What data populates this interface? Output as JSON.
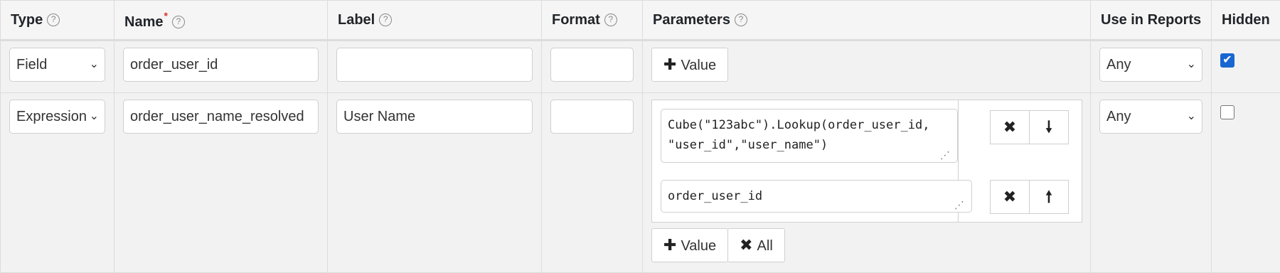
{
  "headers": {
    "type": "Type",
    "name": "Name",
    "label": "Label",
    "format": "Format",
    "parameters": "Parameters",
    "use_in_reports": "Use in Reports",
    "hidden": "Hidden",
    "help_glyph": "?",
    "required_mark": "*"
  },
  "rows": [
    {
      "type": "Field",
      "name": "order_user_id",
      "label": "",
      "format": "",
      "add_value_label": "Value",
      "use_in_reports": "Any",
      "hidden": true
    },
    {
      "type": "Expression",
      "name": "order_user_name_resolved",
      "label": "User Name",
      "format": "",
      "params": [
        "Cube(\"123abc\").Lookup(order_user_id,\n\"user_id\",\"user_name\")",
        "order_user_id"
      ],
      "add_value_label": "Value",
      "remove_all_label": "All",
      "use_in_reports": "Any",
      "hidden": false
    }
  ],
  "icons": {
    "plus": "✚",
    "times": "✖",
    "arrow_down": "🠗",
    "arrow_up": "🠕",
    "chevron": "⌄",
    "check": "✔",
    "grip": "⋰"
  }
}
